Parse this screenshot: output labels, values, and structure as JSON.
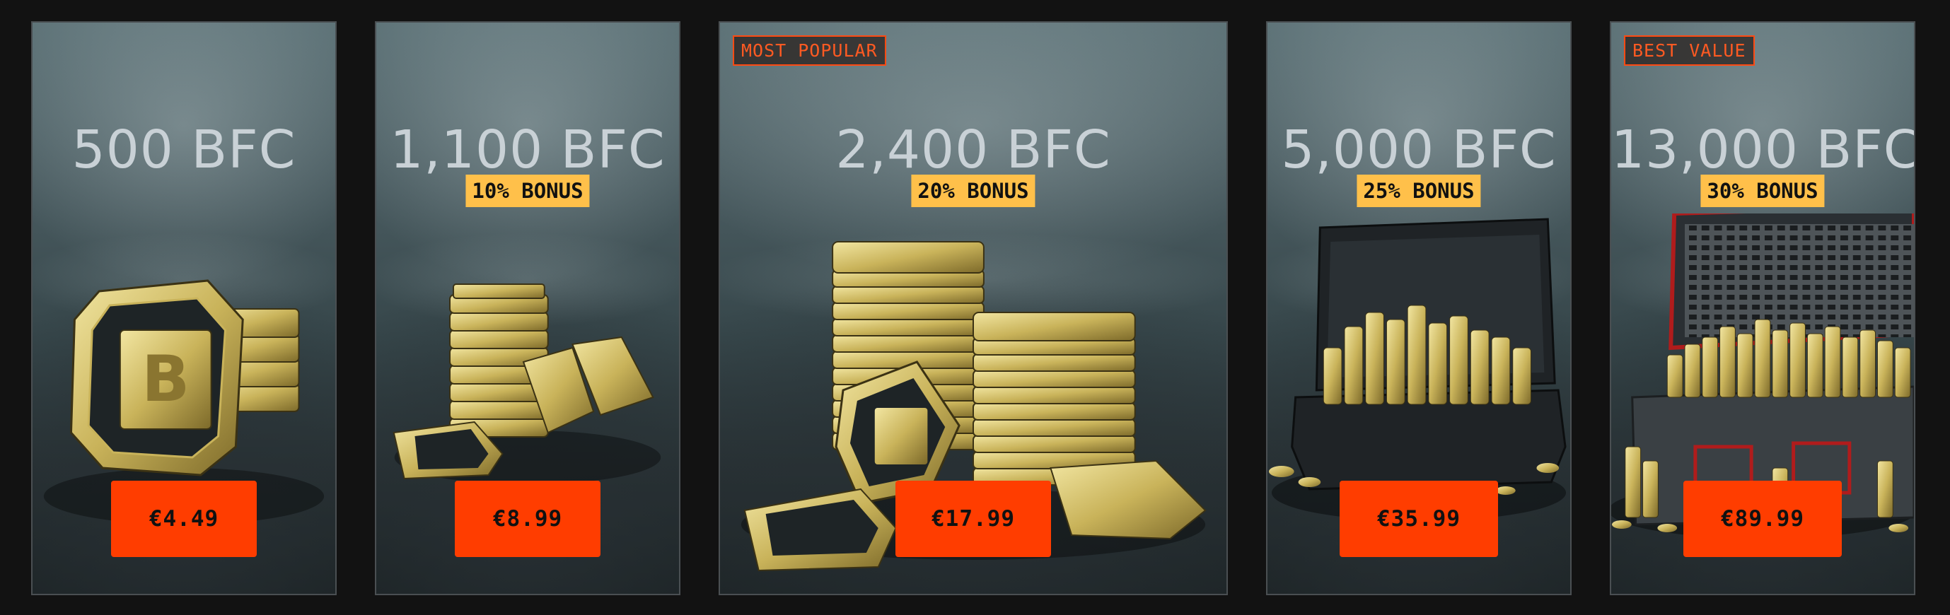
{
  "currency": "BFC",
  "colors": {
    "accent": "#ff3d00",
    "bonus_badge": "#ffc04a",
    "background": "#121212",
    "tag_border": "#ff4a12"
  },
  "packs": [
    {
      "amount": "500 BFC",
      "bonus": null,
      "tag": null,
      "price": "€4.49",
      "art_icon": "coin-stack-small-icon"
    },
    {
      "amount": "1,100 BFC",
      "bonus": "10% BONUS",
      "tag": null,
      "price": "€8.99",
      "art_icon": "coin-stacks-icon"
    },
    {
      "amount": "2,400 BFC",
      "bonus": "20% BONUS",
      "tag": "MOST POPULAR",
      "price": "€17.99",
      "art_icon": "coin-towers-icon"
    },
    {
      "amount": "5,000 BFC",
      "bonus": "25% BONUS",
      "tag": null,
      "price": "€35.99",
      "art_icon": "coin-case-icon"
    },
    {
      "amount": "13,000 BFC",
      "bonus": "30% BONUS",
      "tag": "BEST VALUE",
      "price": "€89.99",
      "art_icon": "coin-crate-icon"
    }
  ]
}
